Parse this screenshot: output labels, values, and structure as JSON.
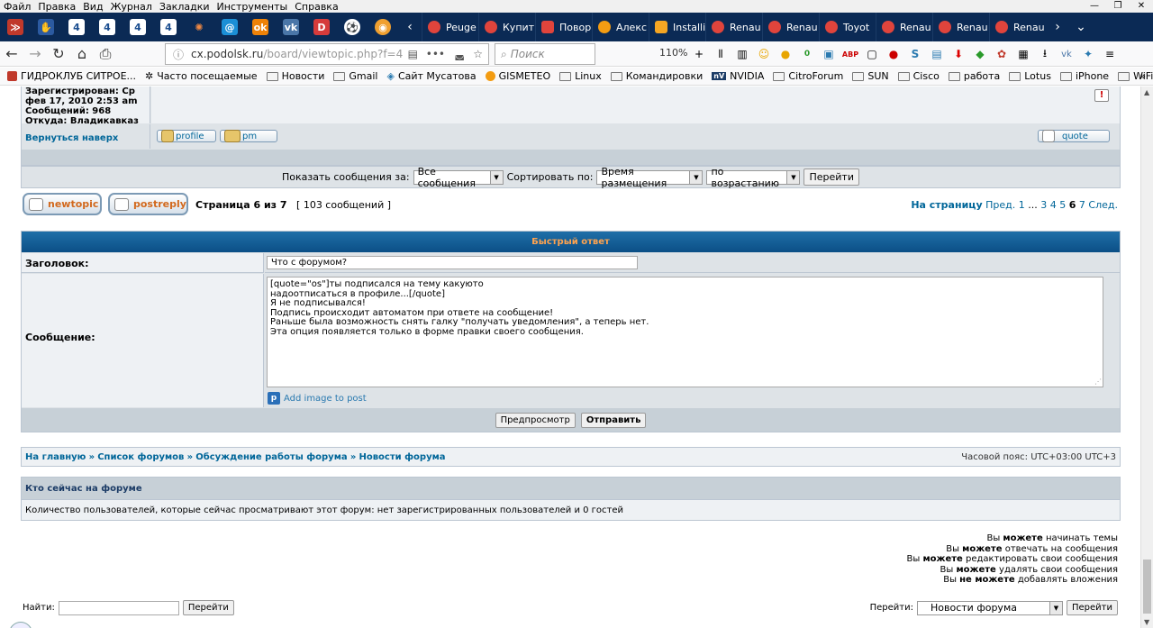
{
  "menu": [
    "Файл",
    "Правка",
    "Вид",
    "Журнал",
    "Закладки",
    "Инструменты",
    "Справка"
  ],
  "tabs": [
    "Peuge",
    "Купит",
    "Повор",
    "Алекс",
    "Installi",
    "Renau",
    "Renau",
    "Toyot",
    "Renau",
    "Renau",
    "Renau"
  ],
  "pinned_tabs": [
    "4",
    "4",
    "4",
    "4"
  ],
  "nav": {
    "url": "cx.podolsk.ru",
    "url_path": "/board/viewtopic.php?f=4",
    "search_placeholder": "Поиск",
    "zoom": "110%",
    "addon_badge": "0"
  },
  "bookmarks": [
    "ГИДРОКЛУБ СИТРОЕ...",
    "Часто посещаемые",
    "Новости",
    "Gmail",
    "Сайт Мусатова",
    "GISMETEO",
    "Linux",
    "Командировки",
    "NVIDIA",
    "CitroForum",
    "SUN",
    "Cisco",
    "работа",
    "Lotus",
    "iPhone",
    "WiFi"
  ],
  "post": {
    "registered": "Зарегистрирован: Ср",
    "registered_date": "фев 17, 2010 2:53 am",
    "messages": "Сообщений: 968",
    "from": "Откуда: Владикавказ",
    "back_to_top": "Вернуться наверх",
    "profile": "profile",
    "pm": "pm",
    "quote": "quote"
  },
  "filter": {
    "show_label": "Показать сообщения за:",
    "show_value": "Все сообщения",
    "sort_label": "Сортировать по:",
    "sort_value": "Время размещения",
    "order_value": "по возрастанию",
    "go": "Перейти"
  },
  "pager": {
    "newtopic": "newtopic",
    "postreply": "postreply",
    "page_info": "Страница 6 из 7",
    "count": "[ 103 сообщений ]",
    "to_page": "На страницу",
    "prev": "Пред.",
    "p1": "1",
    "ellipsis": "...",
    "p3": "3",
    "p4": "4",
    "p5": "5",
    "p6": "6",
    "p7": "7",
    "next": "След."
  },
  "quick_reply": {
    "title": "Быстрый ответ",
    "subject_label": "Заголовок:",
    "subject_value": "Что с форумом?",
    "message_label": "Сообщение:",
    "message_lines": [
      "[quote=\"os\"]ты подписался на тему какуюто",
      "надоотписаться в профиле...[/quote]",
      "Я не подписывался!",
      "Подпись происходит автоматом при ответе на сообщение!",
      "Раньше была возможность снять галку \"получать уведомления\", а теперь нет.",
      "Эта опция появляется только в форме правки своего сообщения."
    ],
    "add_image": "Add image to post",
    "preview": "Предпросмотр",
    "submit": "Отправить"
  },
  "breadcrumb": {
    "home": "На главную",
    "sep": "»",
    "list": "Список форумов",
    "discuss": "Обсуждение работы форума",
    "news": "Новости форума",
    "timezone": "Часовой пояс: UTC+03:00 UTC+3"
  },
  "online": {
    "title": "Кто сейчас на форуме",
    "text": "Количество пользователей, которые сейчас просматривают этот форум: нет зарегистрированных пользователей и 0 гостей"
  },
  "permissions": [
    {
      "pre": "Вы ",
      "strong": "можете",
      "post": " начинать темы"
    },
    {
      "pre": "Вы ",
      "strong": "можете",
      "post": " отвечать на сообщения"
    },
    {
      "pre": "Вы ",
      "strong": "можете",
      "post": " редактировать свои сообщения"
    },
    {
      "pre": "Вы ",
      "strong": "можете",
      "post": " удалять свои сообщения"
    },
    {
      "pre": "Вы ",
      "strong": "не можете",
      "post": " добавлять вложения"
    }
  ],
  "footer": {
    "find_label": "Найти:",
    "find_go": "Перейти",
    "jump_label": "Перейти:",
    "jump_value": "Новости форума",
    "jump_go": "Перейти"
  }
}
